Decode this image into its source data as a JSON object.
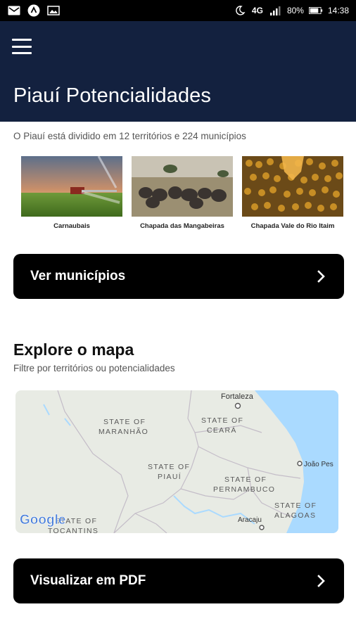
{
  "status_bar": {
    "signal": "4G",
    "battery": "80%",
    "time": "14:38"
  },
  "app_bar": {
    "title": "Piauí Potencialidades"
  },
  "intro": {
    "text": "O Piauí está dividido em 12 territórios e 224 municípios"
  },
  "territories": [
    {
      "label": "Carnaubais"
    },
    {
      "label": "Chapada das Mangabeiras"
    },
    {
      "label": "Chapada Vale do Rio Itaim"
    }
  ],
  "buttons": {
    "municipios": "Ver municípios",
    "pdf": "Visualizar em PDF"
  },
  "explore": {
    "title": "Explore o mapa",
    "subtitle": "Filtre por territórios ou potencialidades"
  },
  "map": {
    "labels": {
      "fortaleza": "Fortaleza",
      "maranhao_1": "STATE OF",
      "maranhao_2": "MARANHÃO",
      "ceara_1": "STATE OF",
      "ceara_2": "CEARÁ",
      "piaui_1": "STATE OF",
      "piaui_2": "PIAUÍ",
      "pernambuco_1": "STATE OF",
      "pernambuco_2": "PERNAMBUCO",
      "alagoas_1": "STATE OF",
      "alagoas_2": "ALAGOAS",
      "tocantins_1": "STATE OF",
      "tocantins_2": "TOCANTINS",
      "joao_pessoa": "João Pes",
      "aracaju": "Aracaju",
      "logo": "Google"
    },
    "colors": {
      "land": "#e8ebe4",
      "water": "#aadaff",
      "border": "#c4bdc8"
    }
  }
}
